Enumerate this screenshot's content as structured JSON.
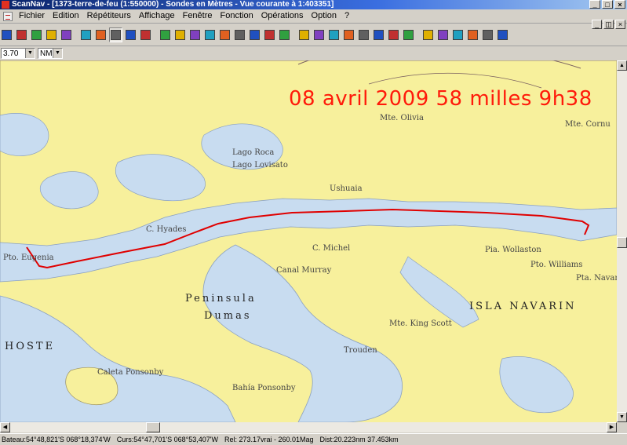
{
  "window": {
    "title": "ScanNav - [1373-terre-de-feu (1:550000) - Sondes en  Mètres  - Vue courante à 1:403351]"
  },
  "menu": [
    "Fichier",
    "Edition",
    "Répétiteurs",
    "Affichage",
    "Fenêtre",
    "Fonction",
    "Opérations",
    "Option",
    "?"
  ],
  "toolbar": {
    "buttons": [
      "open-chart",
      "print-preview",
      "save",
      "print",
      "help-pointer",
      "zoom-in",
      "zoom-out",
      "pan-hand",
      "select-rect",
      "window",
      "boat",
      "center-cross",
      "route",
      "waypoint",
      "mark",
      "track",
      "measure",
      "text",
      "layers",
      "compass",
      "alarm",
      "info",
      "man-overboard",
      "gps",
      "tide",
      "lifebuoy",
      "bar-chart",
      "bar-chart-alt",
      "grid",
      "grid-alt",
      "wind",
      "ruler",
      "identify"
    ],
    "pressed": "pan-hand"
  },
  "controls": {
    "scale_value": "3.70",
    "unit_value": "NM"
  },
  "map": {
    "annotation": "08 avril 2009 58 milles 9h38",
    "annotation_color": "#ff1a0a",
    "labels": [
      {
        "t": "Peninsula",
        "big": true
      },
      {
        "t": "Dumas",
        "big": true
      },
      {
        "t": "ISLA NAVARIN",
        "big": true
      },
      {
        "t": "HOSTE",
        "big": true
      },
      {
        "t": "C. Hyades"
      },
      {
        "t": "C. Michel"
      },
      {
        "t": "Ushuaia"
      },
      {
        "t": "Mte. Olivia"
      },
      {
        "t": "Mte. Cornu"
      },
      {
        "t": "Trouden"
      },
      {
        "t": "Lago Lovisato"
      },
      {
        "t": "Lago Roca"
      },
      {
        "t": "Pto. Williams"
      },
      {
        "t": "Pta. Navarino"
      },
      {
        "t": "Canal Murray"
      },
      {
        "t": "Pto. Eugenia"
      },
      {
        "t": "Bahía Ponsonby"
      },
      {
        "t": "Mte. King Scott"
      },
      {
        "t": "Caleta Ponsonby"
      },
      {
        "t": "Pia. Wollaston"
      }
    ]
  },
  "status": {
    "boat": "Bateau:54°48,821'S 068°18,374'W",
    "cursor": "Curs:54°47,701'S 068°53,407'W",
    "rel": "Rel: 273.17vrai - 260.01Mag",
    "dist": "Dist:20.223nm  37.453km"
  }
}
